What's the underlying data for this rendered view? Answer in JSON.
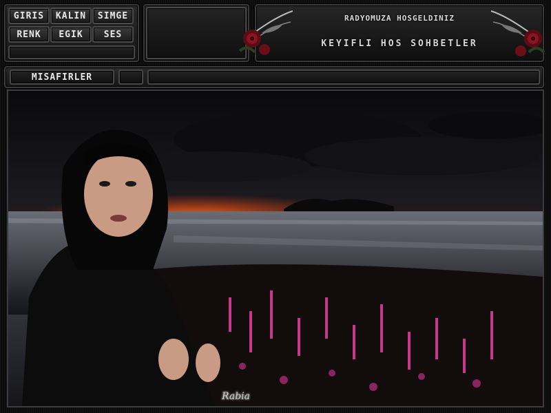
{
  "nav": {
    "buttons": [
      {
        "label": "GIRIS"
      },
      {
        "label": "KALIN"
      },
      {
        "label": "SIMGE"
      },
      {
        "label": "RENK"
      },
      {
        "label": "EGIK"
      },
      {
        "label": "SES"
      }
    ]
  },
  "banner": {
    "welcome_text": "RADYOMUZA HOSGELDINIZ",
    "tagline": "KEYIFLI HOS SOHBETLER",
    "icons": [
      "rose-icon",
      "rose-icon"
    ]
  },
  "guests": {
    "label": "MISAFIRLER"
  },
  "scene": {
    "signature": "Rabia",
    "colors": {
      "sky": "#1a1a1f",
      "sunset": "#ff3a0a",
      "water": "#3a3c44",
      "flowers": "#c8388a"
    }
  }
}
